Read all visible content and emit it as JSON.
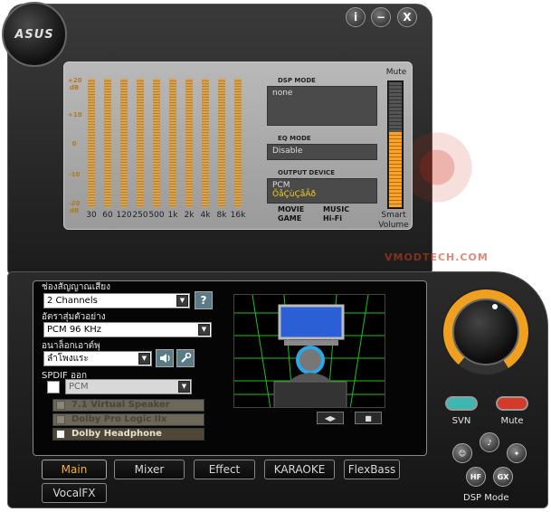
{
  "window": {
    "logo": "ASUS",
    "info_glyph": "i",
    "minimize_glyph": "−",
    "close_glyph": "X"
  },
  "eq": {
    "db_labels": [
      "+20 dB",
      "+10",
      "0",
      "-10",
      "-20 dB"
    ],
    "bands": [
      "30",
      "60",
      "120",
      "250",
      "500",
      "1k",
      "2k",
      "4k",
      "8k",
      "16k"
    ],
    "color": "#d9a24e"
  },
  "dsp_mode": {
    "title": "DSP MODE",
    "value": "none"
  },
  "eq_mode": {
    "title": "EQ MODE",
    "value": "Disable"
  },
  "output_device": {
    "title": "OUTPUT DEVICE",
    "line1": "PCM",
    "line2": "ÕåÇùÇåÃð"
  },
  "mode_labels": {
    "col1_line1": "MOVIE",
    "col1_line2": "GAME",
    "col2_line1": "MUSIC",
    "col2_line2": "Hi-Fi"
  },
  "volume": {
    "mute_label": "Mute",
    "smart_line1": "Smart",
    "smart_line2": "Volume",
    "level": 0.6,
    "color": "#f7a42a"
  },
  "watermark": "VMODTECH.COM",
  "main": {
    "channels_label": "ช่องสัญญาณเสียง",
    "channels_value": "2 Channels",
    "help_glyph": "?",
    "sample_rate_label": "อัตราสุ่มตัวอย่าง",
    "sample_rate_value": "PCM 96 KHz",
    "analog_out_label": "อนาล็อกเอาต์พุ",
    "analog_out_value": "ลำโพงแระ",
    "spdif_label": "SPDIF ออก",
    "spdif_value": "PCM",
    "options": [
      {
        "label": "7.1 Virtual Speaker",
        "enabled": false
      },
      {
        "label": "Dolby Pro Logic IIx",
        "enabled": false
      },
      {
        "label": "Dolby Headphone",
        "enabled": true
      }
    ],
    "play_glyph": "◀▶",
    "stop_glyph": "■"
  },
  "tabs": [
    "Main",
    "Mixer",
    "Effect",
    "KARAOKE",
    "FlexBass",
    "VocalFX"
  ],
  "side": {
    "svn_label": "SVN",
    "mute_label": "Mute",
    "svn_color": "#3fb6b0",
    "mute_color": "#d23a2a",
    "dsp_buttons": [
      "☺",
      "♪",
      "✦",
      "HF",
      "GX"
    ],
    "dsp_mode_label": "DSP Mode"
  }
}
